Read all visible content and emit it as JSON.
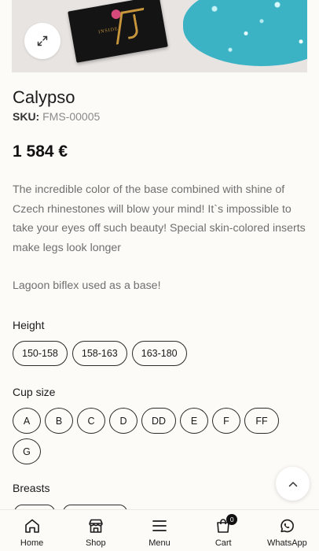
{
  "product": {
    "title": "Calypso",
    "sku_label": "SKU:",
    "sku_value": "FMS-00005",
    "price": "1 584 €",
    "description": [
      "The incredible color of the base combined with shine of Czech rhinestones will blow your mind! It`s impossible to take your eyes off such beauty! Special skin-colored inserts make legs look longer",
      "Lagoon biflex used as a base!"
    ],
    "image_card_text": "INSIDE"
  },
  "options": {
    "height": {
      "label": "Height",
      "values": [
        "150-158",
        "158-163",
        "163-180"
      ]
    },
    "cup_size": {
      "label": "Cup size",
      "values": [
        "A",
        "B",
        "C",
        "D",
        "DD",
        "E",
        "F",
        "FF",
        "G"
      ]
    },
    "breasts": {
      "label": "Breasts"
    }
  },
  "nav": {
    "items": [
      {
        "label": "Home",
        "icon": "home-icon"
      },
      {
        "label": "Shop",
        "icon": "shop-icon"
      },
      {
        "label": "Menu",
        "icon": "menu-icon"
      },
      {
        "label": "Cart",
        "icon": "cart-icon",
        "badge": "0"
      },
      {
        "label": "WhatsApp",
        "icon": "whatsapp-icon"
      }
    ]
  },
  "colors": {
    "accent_gold": "#c8963c",
    "background": "#fdfbf8",
    "text": "#1a1a1a"
  }
}
